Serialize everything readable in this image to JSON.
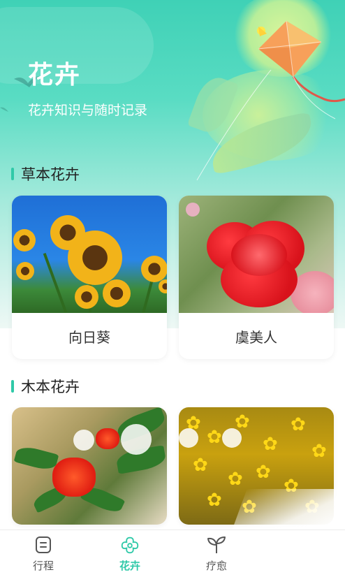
{
  "header": {
    "title": "花卉",
    "subtitle": "花卉知识与随时记录"
  },
  "sections": [
    {
      "title": "草本花卉",
      "cards": [
        {
          "label": "向日葵",
          "image": "sunflower-photo"
        },
        {
          "label": "虞美人",
          "image": "poppy-photo"
        }
      ]
    },
    {
      "title": "木本花卉",
      "cards": [
        {
          "label": "",
          "image": "pomegranate-flower-photo"
        },
        {
          "label": "",
          "image": "winter-jasmine-photo"
        }
      ]
    }
  ],
  "tabbar": {
    "items": [
      {
        "label": "行程",
        "icon": "itinerary-icon",
        "active": false
      },
      {
        "label": "花卉",
        "icon": "flower-icon",
        "active": true
      },
      {
        "label": "疗愈",
        "icon": "sprout-icon",
        "active": false
      }
    ]
  },
  "colors": {
    "accent": "#2fc9a8",
    "header_gradient_top": "#3fd1b6",
    "text_primary": "#222222"
  }
}
